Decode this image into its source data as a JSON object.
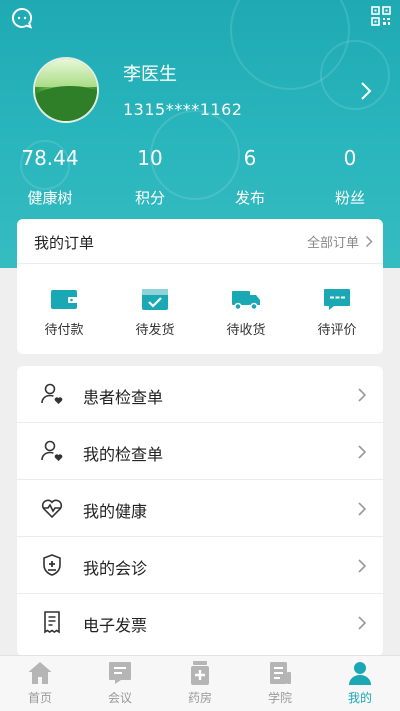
{
  "colors": {
    "primary": "#1aa9b4",
    "header_bg": "#2ab6bd",
    "inactive_tab": "#b5b5b5",
    "text_muted": "#888888"
  },
  "header": {
    "message_icon": "chat-bubble-icon",
    "qr_icon": "qr-code-icon"
  },
  "profile": {
    "name": "李医生",
    "phone": "1315****1162",
    "avatar": "landscape-avatar"
  },
  "stats": [
    {
      "value": "78.44",
      "label": "健康树"
    },
    {
      "value": "10",
      "label": "积分"
    },
    {
      "value": "6",
      "label": "发布"
    },
    {
      "value": "0",
      "label": "粉丝"
    }
  ],
  "orders": {
    "title": "我的订单",
    "all_label": "全部订单",
    "items": [
      {
        "label": "待付款",
        "icon": "wallet-icon"
      },
      {
        "label": "待发货",
        "icon": "package-check-icon"
      },
      {
        "label": "待收货",
        "icon": "truck-icon"
      },
      {
        "label": "待评价",
        "icon": "comment-icon"
      }
    ]
  },
  "menu": [
    {
      "label": "患者检查单",
      "icon": "user-heart-icon"
    },
    {
      "label": "我的检查单",
      "icon": "user-heart-icon"
    },
    {
      "label": "我的健康",
      "icon": "heartbeat-icon"
    },
    {
      "label": "我的会诊",
      "icon": "medical-shield-icon"
    },
    {
      "label": "电子发票",
      "icon": "receipt-icon"
    }
  ],
  "tabbar": {
    "active_index": 4,
    "tabs": [
      {
        "label": "首页",
        "icon": "home-icon"
      },
      {
        "label": "会议",
        "icon": "meeting-icon"
      },
      {
        "label": "药房",
        "icon": "pharmacy-icon"
      },
      {
        "label": "学院",
        "icon": "academy-icon"
      },
      {
        "label": "我的",
        "icon": "profile-icon"
      }
    ]
  }
}
